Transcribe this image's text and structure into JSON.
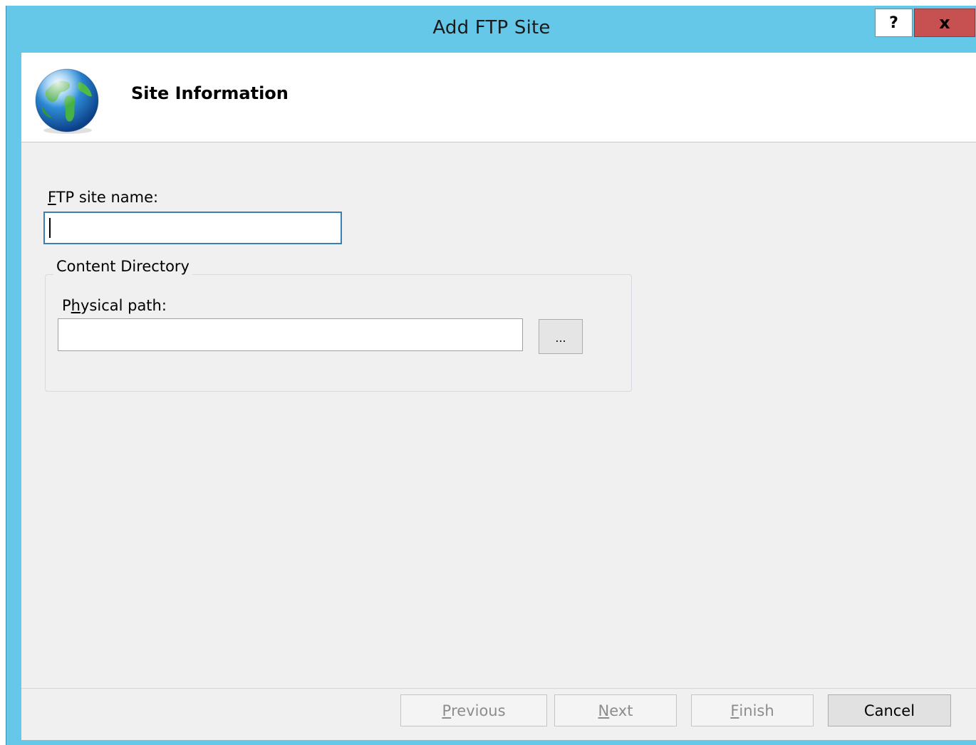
{
  "window": {
    "title": "Add FTP Site",
    "help_glyph": "?",
    "close_glyph": "x"
  },
  "header": {
    "icon": "globe-icon",
    "title": "Site Information"
  },
  "form": {
    "site_name": {
      "label_accel": "F",
      "label_rest": "TP site name:",
      "value": ""
    },
    "content_directory": {
      "legend": "Content Directory",
      "physical_path": {
        "label_pre": "P",
        "label_accel": "h",
        "label_rest": "ysical path:",
        "value": ""
      },
      "browse_label": "..."
    }
  },
  "footer": {
    "previous": {
      "accel": "P",
      "rest": "revious",
      "enabled": false
    },
    "next": {
      "accel": "N",
      "rest": "ext",
      "enabled": false
    },
    "finish": {
      "accel": "F",
      "rest": "inish",
      "enabled": false
    },
    "cancel": {
      "label": "Cancel",
      "enabled": true
    }
  },
  "colors": {
    "titlebar": "#66c8e8",
    "close_button": "#c75050",
    "client_background": "#f0f0f0",
    "focus_border": "#3c7fb1"
  }
}
